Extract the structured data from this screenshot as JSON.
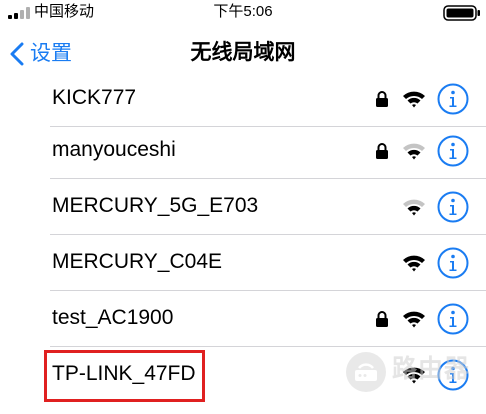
{
  "status_bar": {
    "carrier": "中国移动",
    "time": "下午5:06"
  },
  "nav": {
    "back_label": "设置",
    "title": "无线局域网"
  },
  "networks": [
    {
      "ssid": "KICK777",
      "locked": true,
      "signal": "full"
    },
    {
      "ssid": "manyouceshi",
      "locked": true,
      "signal": "weak"
    },
    {
      "ssid": "MERCURY_5G_E703",
      "locked": false,
      "signal": "weak"
    },
    {
      "ssid": "MERCURY_C04E",
      "locked": false,
      "signal": "full"
    },
    {
      "ssid": "test_AC1900",
      "locked": true,
      "signal": "full"
    },
    {
      "ssid": "TP-LINK_47FD",
      "locked": false,
      "signal": "full"
    }
  ],
  "colors": {
    "accent": "#1a7cf2",
    "highlight": "#e02020"
  },
  "icons": [
    "signal-icon",
    "battery-icon",
    "chevron-left-icon",
    "lock-icon",
    "wifi-icon",
    "info-icon"
  ],
  "watermark": {
    "text": "路由器"
  }
}
